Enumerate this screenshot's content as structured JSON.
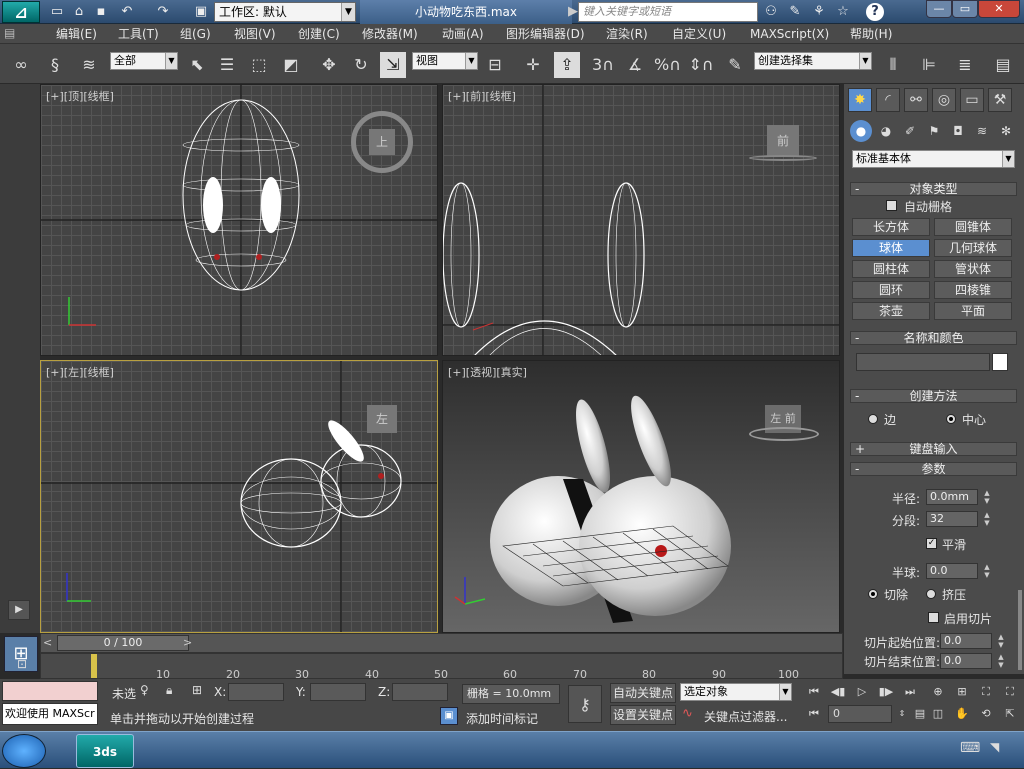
{
  "window": {
    "workspace_label": "工作区: 默认",
    "document_title": "小动物吃东西.max",
    "search_placeholder": "键入关键字或短语",
    "help_label": "?"
  },
  "menu": [
    "编辑(E)",
    "工具(T)",
    "组(G)",
    "视图(V)",
    "创建(C)",
    "修改器(M)",
    "动画(A)",
    "图形编辑器(D)",
    "渲染(R)",
    "自定义(U)",
    "MAXScript(X)",
    "帮助(H)"
  ],
  "toolbar": {
    "selection_filter": "全部",
    "ref_coord": "视图",
    "named_selection": "创建选择集",
    "snap_label": "3",
    "percent_label": "%"
  },
  "viewports": {
    "top": {
      "label": "[+][顶][线框]",
      "cube_label": "上"
    },
    "front": {
      "label": "[+][前][线框]",
      "cube_label": "前"
    },
    "left": {
      "label": "[+][左][线框]",
      "cube_label": "左"
    },
    "perspective": {
      "label": "[+][透视][真实]",
      "cube_label": "左 前"
    }
  },
  "command_panel": {
    "category_dropdown": "标准基本体",
    "object_type_title": "对象类型",
    "autogrid_label": "自动栅格",
    "object_buttons": [
      [
        "长方体",
        "圆锥体"
      ],
      [
        "球体",
        "几何球体"
      ],
      [
        "圆柱体",
        "管状体"
      ],
      [
        "圆环",
        "四棱锥"
      ],
      [
        "茶壶",
        "平面"
      ]
    ],
    "name_color_title": "名称和颜色",
    "creation_method_title": "创建方法",
    "creation_edge": "边",
    "creation_center": "中心",
    "keyboard_entry_title": "键盘输入",
    "parameters_title": "参数",
    "radius_label": "半径:",
    "radius_value": "0.0mm",
    "segments_label": "分段:",
    "segments_value": "32",
    "smooth_label": "平滑",
    "hemisphere_label": "半球:",
    "hemisphere_value": "0.0",
    "chop_label": "切除",
    "squash_label": "挤压",
    "slice_on_label": "启用切片",
    "slice_from_label": "切片起始位置:",
    "slice_from_value": "0.0",
    "slice_to_label": "切片结束位置:",
    "slice_to_value": "0.0"
  },
  "timeline": {
    "frame_display": "0 / 100",
    "ticks": [
      "10",
      "20",
      "30",
      "40",
      "50",
      "60",
      "70",
      "80",
      "90",
      "100"
    ]
  },
  "status": {
    "mini_listener": "欢迎使用  MAXScr",
    "selection_text": "未选",
    "prompt": "单击并拖动以开始创建过程",
    "x_label": "X:",
    "y_label": "Y:",
    "z_label": "Z:",
    "grid_label": "栅格 = 10.0mm",
    "add_time_tag": "添加时间标记",
    "auto_key": "自动关键点",
    "set_key": "设置关键点",
    "key_mode_dropdown": "选定对象",
    "key_filters": "关键点过滤器...",
    "current_frame": "0"
  },
  "colors": {
    "accent": "#5b8fd0",
    "color_swatch": "#ffffff",
    "listener_bg": "#f2d0d0"
  }
}
